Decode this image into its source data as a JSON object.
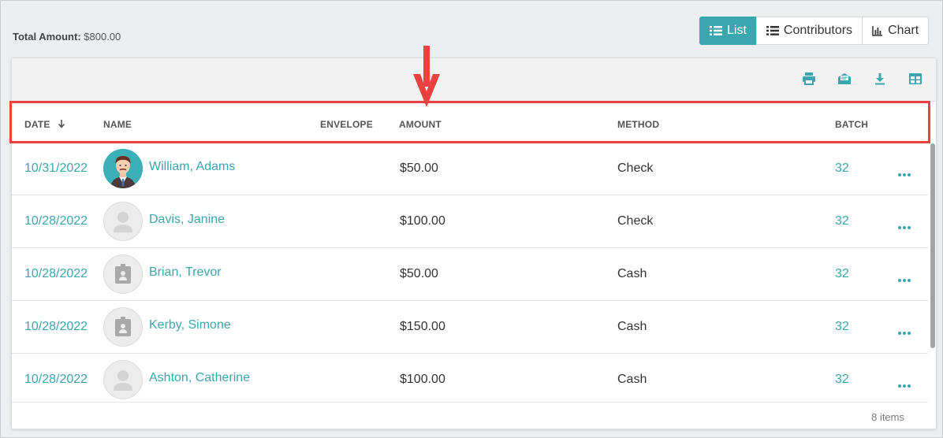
{
  "summary": {
    "total_label": "Total Amount:",
    "total_value": "$800.00"
  },
  "view_toggle": [
    {
      "label": "List",
      "icon": "list-icon",
      "active": true
    },
    {
      "label": "Contributors",
      "icon": "list-icon",
      "active": false
    },
    {
      "label": "Chart",
      "icon": "bar-chart-icon",
      "active": false
    }
  ],
  "toolbar": {
    "icons": [
      "print-icon",
      "email-icon",
      "download-icon",
      "table-icon"
    ]
  },
  "table": {
    "columns": {
      "date": "DATE",
      "name": "NAME",
      "envelope": "ENVELOPE",
      "amount": "AMOUNT",
      "method": "METHOD",
      "batch": "BATCH"
    },
    "sort_icon": "arrow-down-icon",
    "rows": [
      {
        "date": "10/31/2022",
        "name": "William, Adams",
        "amount": "$50.00",
        "method": "Check",
        "batch": "32",
        "avatar": "person-photo"
      },
      {
        "date": "10/28/2022",
        "name": "Davis, Janine",
        "amount": "$100.00",
        "method": "Check",
        "batch": "32",
        "avatar": "person-placeholder"
      },
      {
        "date": "10/28/2022",
        "name": "Brian, Trevor",
        "amount": "$50.00",
        "method": "Cash",
        "batch": "32",
        "avatar": "badge-placeholder"
      },
      {
        "date": "10/28/2022",
        "name": "Kerby, Simone",
        "amount": "$150.00",
        "method": "Cash",
        "batch": "32",
        "avatar": "badge-placeholder"
      },
      {
        "date": "10/28/2022",
        "name": "Ashton, Catherine",
        "amount": "$100.00",
        "method": "Cash",
        "batch": "32",
        "avatar": "person-placeholder"
      }
    ],
    "footer": "8 items"
  },
  "colors": {
    "accent": "#3aa6ad",
    "annotation": "#e9423f"
  }
}
